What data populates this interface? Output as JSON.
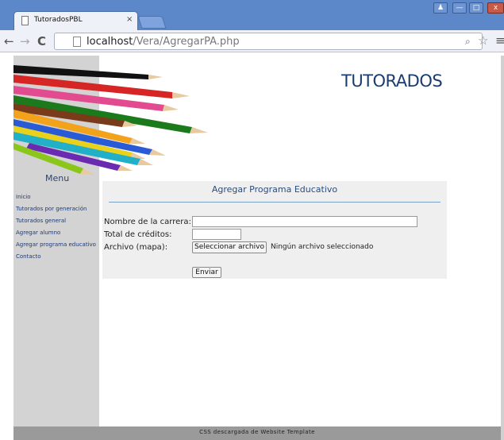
{
  "browser": {
    "tab_title": "TutoradosPBL",
    "tab_close": "×",
    "url_host": "localhost",
    "url_path": "/Vera/AgregarPA.php",
    "window_buttons": {
      "user": "♟",
      "minimize": "—",
      "maximize": "□",
      "close": "x"
    }
  },
  "header": {
    "site_title": "TUTORADOS"
  },
  "sidebar": {
    "menu_heading": "Menu",
    "items": [
      {
        "label": "Inicio"
      },
      {
        "label": "Tutorados por generación"
      },
      {
        "label": "Tutorados general"
      },
      {
        "label": "Agregar alumno"
      },
      {
        "label": "Agregar programa educativo"
      },
      {
        "label": "Contacto"
      }
    ]
  },
  "form": {
    "title": "Agregar Programa Educativo",
    "carrera_label": "Nombre de la carrera:",
    "carrera_value": "",
    "creditos_label": "Total de créditos:",
    "creditos_value": "",
    "archivo_label": "Archivo (mapa):",
    "file_button": "Seleccionar archivo",
    "file_status": "Ningún archivo seleccionado",
    "submit": "Enviar"
  },
  "footer": {
    "text": "CSS descargada de Website Template"
  },
  "colors": {
    "titlebar": "#5c87c9",
    "sidebar": "#d3d3d3",
    "title": "#1a3c6e",
    "footer": "#9a9a9a"
  }
}
